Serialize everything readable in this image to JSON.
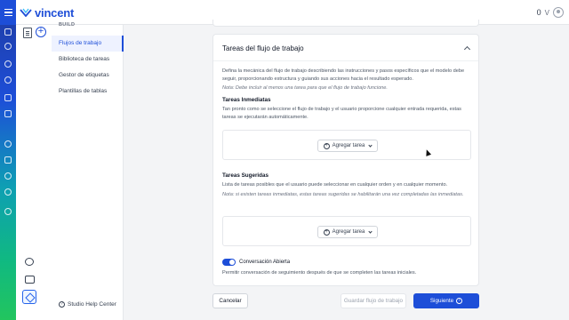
{
  "header": {
    "brand": "vincent",
    "count": "0",
    "user_initial": "V"
  },
  "sidebar": {
    "section": "BUILD",
    "items": [
      {
        "label": "Flujos de trabajo",
        "active": true
      },
      {
        "label": "Biblioteca de tareas",
        "active": false
      },
      {
        "label": "Gestor de etiquetas",
        "active": false
      },
      {
        "label": "Plantillas de tablas",
        "active": false
      }
    ],
    "help_label": "Studio Help Center"
  },
  "card": {
    "title": "Tareas del flujo de trabajo",
    "description": "Defina la mecánica del flujo de trabajo describiendo las instrucciones y pasos específicos que el modelo debe seguir, proporcionando estructura y guiando sus acciones hacia el resultado esperado.",
    "note": "Nota: Debe incluir al menos una tarea para que el flujo de trabajo funcione.",
    "immediate": {
      "title": "Tareas Inmediatas",
      "description": "Tan pronto como se seleccione el flujo de trabajo y el usuario proporcione cualquier entrada requerida, estas tareas se ejecutarán automáticamente.",
      "add_label": "Agregar tarea"
    },
    "suggested": {
      "title": "Tareas Sugeridas",
      "description": "Lista de tareas posibles que el usuario puede seleccionar en cualquier orden y en cualquier momento.",
      "note": "Nota: si existen tareas inmediatas, estas tareas sugeridas se habilitarán una vez completadas las inmediatas.",
      "add_label": "Agregar tarea"
    },
    "open_conversation": {
      "label": "Conversación Abierta",
      "enabled": true,
      "description": "Permitir conversación de seguimiento después de que se completen las tareas iniciales."
    }
  },
  "footer": {
    "cancel": "Cancelar",
    "save": "Guardar flujo de trabajo",
    "next": "Siguiente"
  },
  "colors": {
    "primary": "#1d4ed8",
    "rail_top": "#1e40af",
    "rail_bottom": "#22c55e"
  }
}
